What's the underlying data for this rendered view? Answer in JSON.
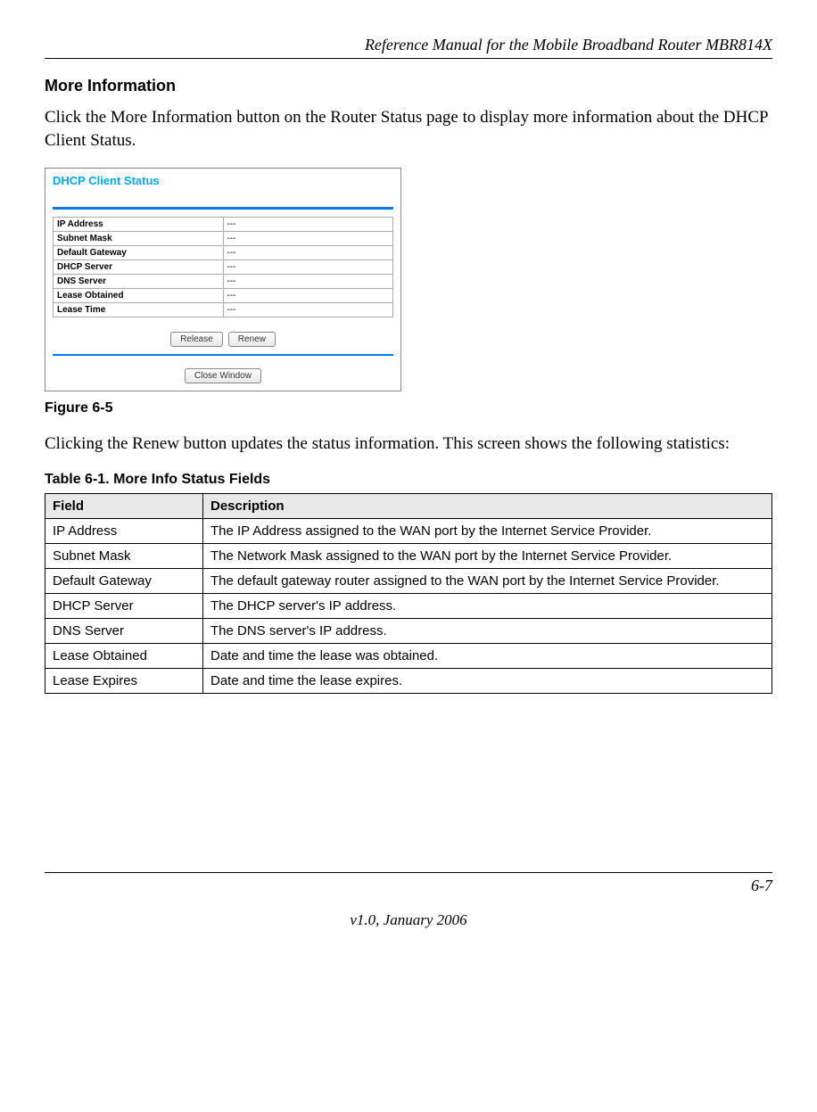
{
  "header": {
    "title": "Reference Manual for the Mobile Broadband Router MBR814X"
  },
  "section": {
    "heading": "More Information",
    "paragraph1": "Click the More Information button on the Router Status page to display more information about the DHCP Client Status.",
    "figure_label": "Figure 6-5",
    "paragraph2": "Clicking the Renew button updates the status information. This screen shows the following statistics:"
  },
  "screenshot": {
    "title": "DHCP Client Status",
    "rows": [
      {
        "label": "IP Address",
        "value": "---"
      },
      {
        "label": "Subnet Mask",
        "value": "---"
      },
      {
        "label": "Default Gateway",
        "value": "---"
      },
      {
        "label": "DHCP Server",
        "value": "---"
      },
      {
        "label": "DNS Server",
        "value": "---"
      },
      {
        "label": "Lease Obtained",
        "value": "---"
      },
      {
        "label": "Lease Time",
        "value": "---"
      }
    ],
    "buttons": {
      "release": "Release",
      "renew": "Renew",
      "close": "Close Window"
    }
  },
  "table": {
    "caption": "Table 6-1. More Info Status Fields",
    "headers": {
      "field": "Field",
      "description": "Description"
    },
    "rows": [
      {
        "field": "IP Address",
        "description": "The IP Address assigned to the WAN port by the Internet Service Provider."
      },
      {
        "field": "Subnet Mask",
        "description": "The Network Mask assigned to the WAN port by the Internet Service Provider."
      },
      {
        "field": "Default Gateway",
        "description": "The default gateway router assigned to the WAN port by the Internet Service Provider."
      },
      {
        "field": "DHCP Server",
        "description": "The DHCP server's IP address."
      },
      {
        "field": "DNS Server",
        "description": "The DNS server's IP address."
      },
      {
        "field": "Lease Obtained",
        "description": "Date and time the lease was obtained."
      },
      {
        "field": "Lease Expires",
        "description": "Date and time the lease expires."
      }
    ]
  },
  "footer": {
    "page": "6-7",
    "version": "v1.0, January 2006"
  }
}
